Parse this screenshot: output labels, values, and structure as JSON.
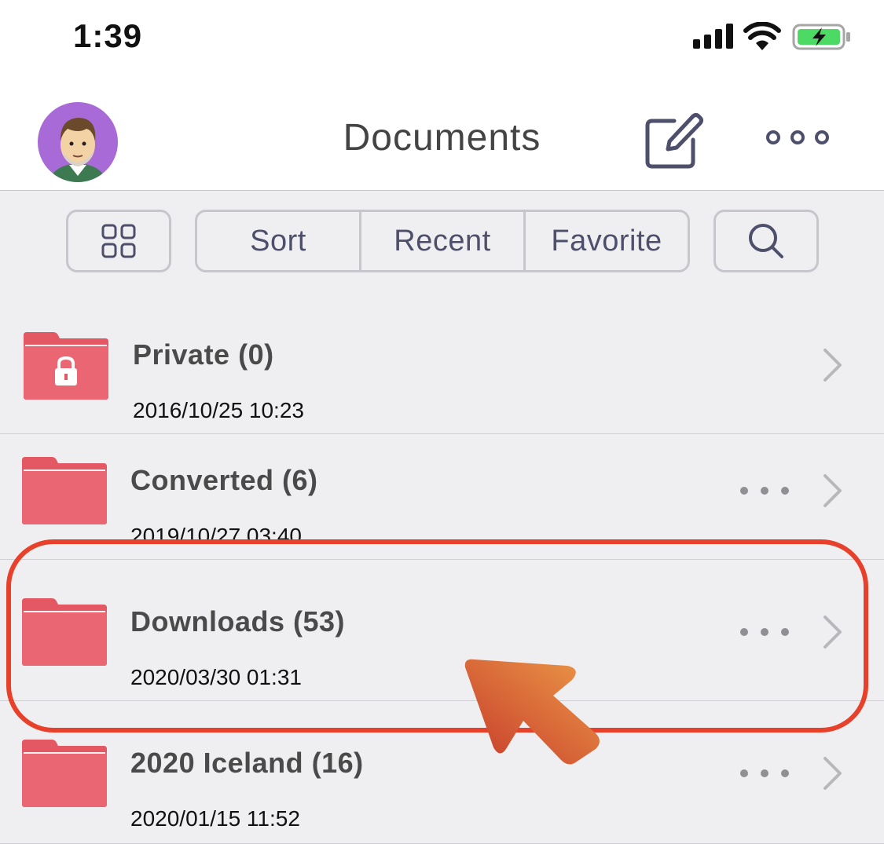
{
  "status_bar": {
    "time": "1:39",
    "signal_icon": "cellular-signal-icon",
    "wifi_icon": "wifi-icon",
    "battery_icon": "battery-charging-icon"
  },
  "header": {
    "title": "Documents",
    "avatar": "user-avatar",
    "edit_icon": "compose-icon",
    "more_icon": "more-horizontal-icon"
  },
  "toolbar": {
    "grid_icon": "grid-view-icon",
    "segments": [
      "Sort",
      "Recent",
      "Favorite"
    ],
    "search_icon": "search-icon"
  },
  "folders": [
    {
      "name": "Private (0)",
      "date": "2016/10/25 10:23",
      "locked": true,
      "has_more": false
    },
    {
      "name": "Converted (6)",
      "date": "2019/10/27 03:40",
      "locked": false,
      "has_more": true
    },
    {
      "name": "Downloads (53)",
      "date": "2020/03/30 01:31",
      "locked": false,
      "has_more": true,
      "highlighted": true
    },
    {
      "name": "2020 Iceland (16)",
      "date": "2020/01/15 11:52",
      "locked": false,
      "has_more": true
    }
  ],
  "colors": {
    "folder": "#e45864",
    "highlight": "#e8412b",
    "accent_text": "#4d4f6b",
    "pointer_arrow": "#d9502f"
  }
}
